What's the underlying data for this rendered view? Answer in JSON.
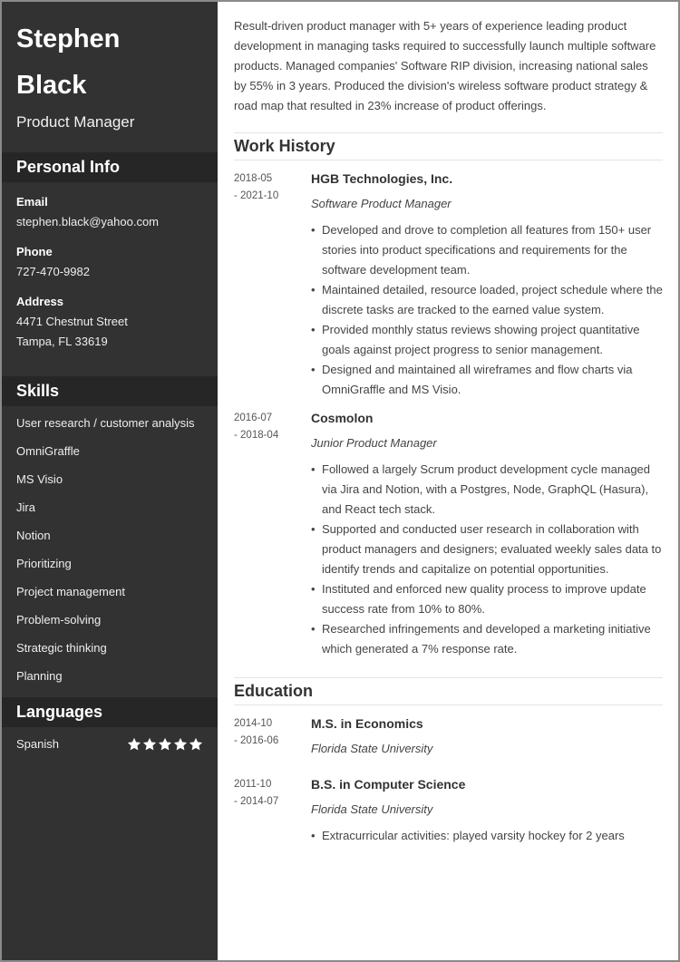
{
  "profile": {
    "first_name": "Stephen",
    "last_name": "Black",
    "job_title": "Product Manager"
  },
  "personal_info": {
    "heading": "Personal Info",
    "email_label": "Email",
    "email": "stephen.black@yahoo.com",
    "phone_label": "Phone",
    "phone": "727-470-9982",
    "address_label": "Address",
    "address_line1": "4471 Chestnut Street",
    "address_line2": "Tampa, FL 33619"
  },
  "skills": {
    "heading": "Skills",
    "items": [
      "User research / customer analysis",
      "OmniGraffle",
      "MS Visio",
      "Jira",
      "Notion",
      "Prioritizing",
      "Project management",
      "Problem-solving",
      "Strategic thinking",
      "Planning"
    ]
  },
  "languages": {
    "heading": "Languages",
    "items": [
      {
        "name": "Spanish",
        "rating": 5,
        "max_rating": 5
      }
    ]
  },
  "summary": "Result-driven product manager with 5+ years of experience leading product development in managing tasks required to successfully launch multiple software products. Managed companies' Software RIP division, increasing national sales by 55% in 3 years. Produced the division's wireless software product strategy & road map that resulted in  23% increase of product offerings.",
  "work_history": {
    "heading": "Work History",
    "entries": [
      {
        "date_start": "2018-05",
        "date_end": "- 2021-10",
        "company": "HGB Technologies, Inc.",
        "role": "Software Product Manager",
        "bullets": [
          "Developed and drove to completion all features from 150+ user stories into product specifications and requirements for the software development team.",
          "Maintained detailed, resource loaded, project schedule where the discrete tasks are tracked to the earned value system.",
          "Provided monthly status reviews showing project quantitative goals against project progress to senior management.",
          "Designed and maintained all wireframes and flow charts via OmniGraffle and MS Visio."
        ]
      },
      {
        "date_start": "2016-07",
        "date_end": "- 2018-04",
        "company": "Cosmolon",
        "role": "Junior Product Manager",
        "bullets": [
          "Followed a largely Scrum product development cycle managed via Jira and Notion, with a Postgres, Node, GraphQL (Hasura), and React tech stack.",
          "Supported and conducted user research in collaboration with product managers and designers; evaluated weekly sales data to identify trends and capitalize on potential opportunities.",
          "Instituted and enforced new quality process to improve update success rate from 10% to 80%.",
          "Researched infringements and developed a marketing initiative which generated a 7% response rate."
        ]
      }
    ]
  },
  "education": {
    "heading": "Education",
    "entries": [
      {
        "date_start": "2014-10",
        "date_end": "- 2016-06",
        "degree": "M.S. in Economics",
        "school": "Florida State University",
        "bullets": []
      },
      {
        "date_start": "2011-10",
        "date_end": "- 2014-07",
        "degree": "B.S. in Computer Science",
        "school": "Florida State University",
        "bullets": [
          "Extracurricular activities: played varsity hockey for 2 years"
        ]
      }
    ]
  },
  "colors": {
    "sidebar_bg": "#323232",
    "sidebar_header_bg": "#262626",
    "star_color": "#ffffff"
  }
}
